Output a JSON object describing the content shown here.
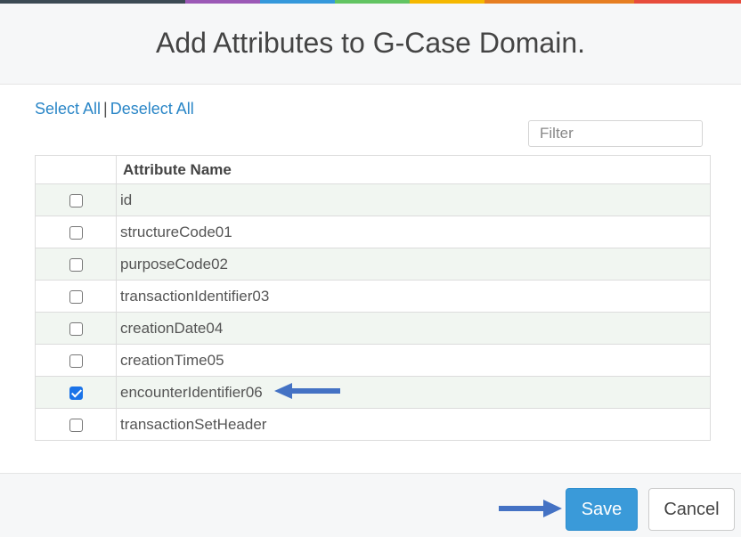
{
  "colors": {
    "topbar": [
      "#3c4a54",
      "#9b59b6",
      "#3498db",
      "#62c462",
      "#f5b800",
      "#e67e22",
      "#e74c3c"
    ],
    "accent": "#3a9ad9",
    "link": "#2a86c7",
    "arrow": "#4472c4",
    "row_stripe": "#f1f6f1"
  },
  "dialog": {
    "title": "Add Attributes to G-Case Domain."
  },
  "select_links": {
    "select_all": "Select All",
    "separator": "|",
    "deselect_all": "Deselect All"
  },
  "filter": {
    "placeholder": "Filter",
    "value": ""
  },
  "table": {
    "column_header": "Attribute Name",
    "rows": [
      {
        "name": "id",
        "checked": false
      },
      {
        "name": "structureCode01",
        "checked": false
      },
      {
        "name": "purposeCode02",
        "checked": false
      },
      {
        "name": "transactionIdentifier03",
        "checked": false
      },
      {
        "name": "creationDate04",
        "checked": false
      },
      {
        "name": "creationTime05",
        "checked": false
      },
      {
        "name": "encounterIdentifier06",
        "checked": true
      },
      {
        "name": "transactionSetHeader",
        "checked": false
      }
    ]
  },
  "footer": {
    "save_label": "Save",
    "cancel_label": "Cancel"
  }
}
